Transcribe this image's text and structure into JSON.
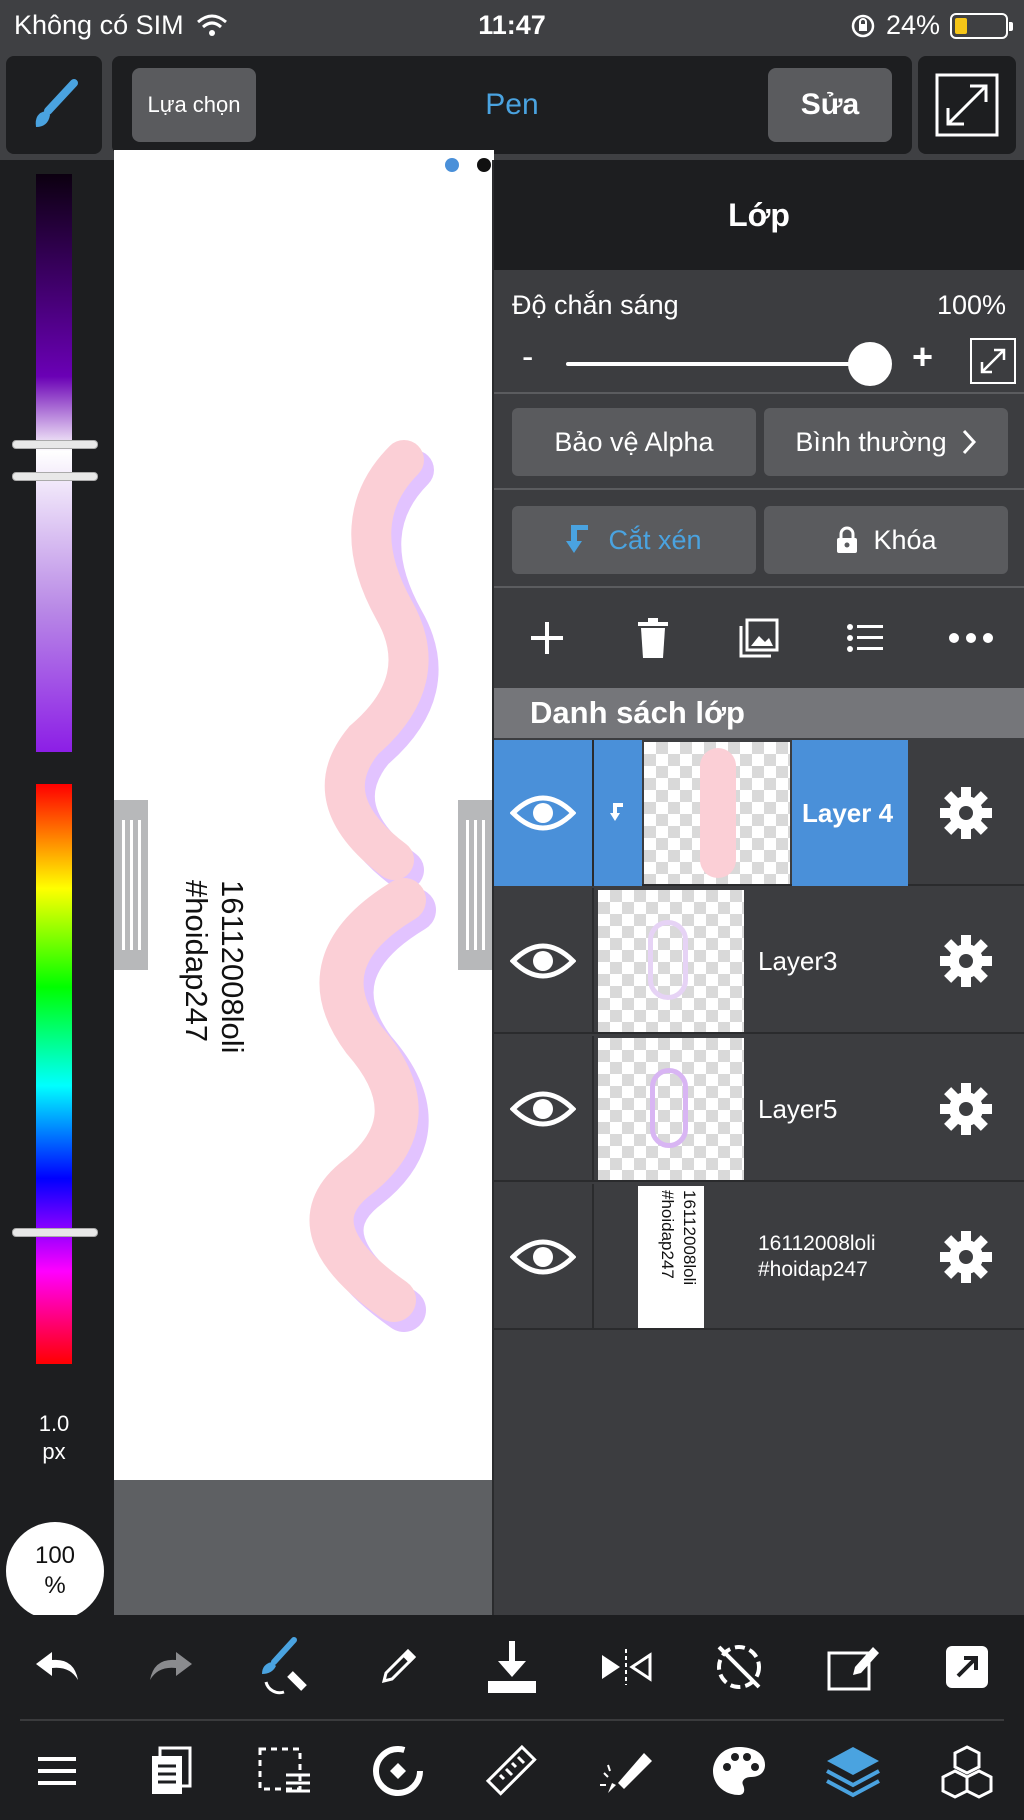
{
  "status_bar": {
    "carrier": "Không có SIM",
    "time": "11:47",
    "battery_percent": "24%",
    "battery_level": 0.24
  },
  "toolbar": {
    "select_label": "Lựa chọn",
    "tool_name": "Pen",
    "edit_label": "Sửa"
  },
  "color_panel": {
    "brush_size_value": "1.0",
    "brush_size_unit": "px",
    "opacity_value": "100",
    "opacity_unit": "%"
  },
  "canvas": {
    "text_line1": "16112008loli",
    "text_line2": "#hoidap247"
  },
  "layer_panel": {
    "title": "Lớp",
    "opacity_label": "Độ chắn sáng",
    "opacity_value": "100%",
    "opacity_minus": "-",
    "opacity_plus": "+",
    "alpha_protect_label": "Bảo vệ Alpha",
    "blend_mode_label": "Bình thường",
    "clipping_label": "Cắt xén",
    "lock_label": "Khóa",
    "list_title": "Danh sách lớp",
    "layers": [
      {
        "name": "Layer 4",
        "selected": true
      },
      {
        "name": "Layer3",
        "selected": false
      },
      {
        "name": "Layer5",
        "selected": false
      },
      {
        "name": "16112008loli #hoidap247",
        "selected": false
      }
    ],
    "text_layer_thumb_line1": "16112008loli",
    "text_layer_thumb_line2": "#hoidap247"
  },
  "colors": {
    "accent": "#4a90d9",
    "panel": "#3c3d40",
    "dark": "#1d1e20"
  }
}
